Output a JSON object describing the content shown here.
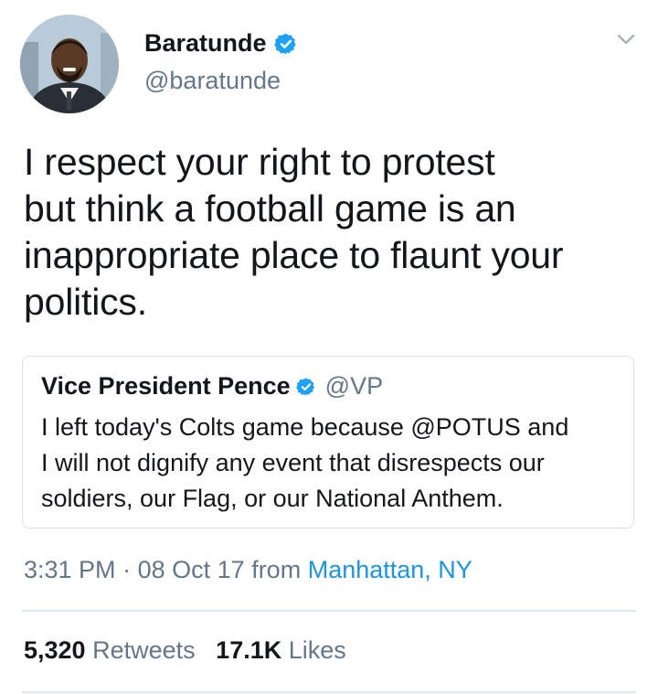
{
  "user": {
    "display_name": "Baratunde",
    "handle": "@baratunde"
  },
  "tweet": {
    "text_lines": [
      "I respect your right to protest",
      "but think a football game is an",
      "inappropriate place to flaunt your",
      "politics."
    ]
  },
  "quoted_tweet": {
    "display_name": "Vice President Pence",
    "handle": "@VP",
    "text_lines": [
      "I left today's Colts game because @POTUS and",
      "I will not dignify any event that disrespects our",
      "soldiers, our Flag, or our National Anthem."
    ]
  },
  "meta": {
    "time": "3:31 PM",
    "separator": "·",
    "date": "08 Oct 17",
    "from_label": "from",
    "location": "Manhattan, NY"
  },
  "stats": {
    "retweets_count": "5,320",
    "retweets_label": "Retweets",
    "likes_count": "17.1K",
    "likes_label": "Likes"
  },
  "icons": {
    "verified": "verified-badge-icon",
    "caret": "chevron-down-icon"
  },
  "colors": {
    "accent": "#1da1f2",
    "location_link": "#1b95e0",
    "secondary_text": "#657786",
    "primary_text": "#14171a"
  }
}
